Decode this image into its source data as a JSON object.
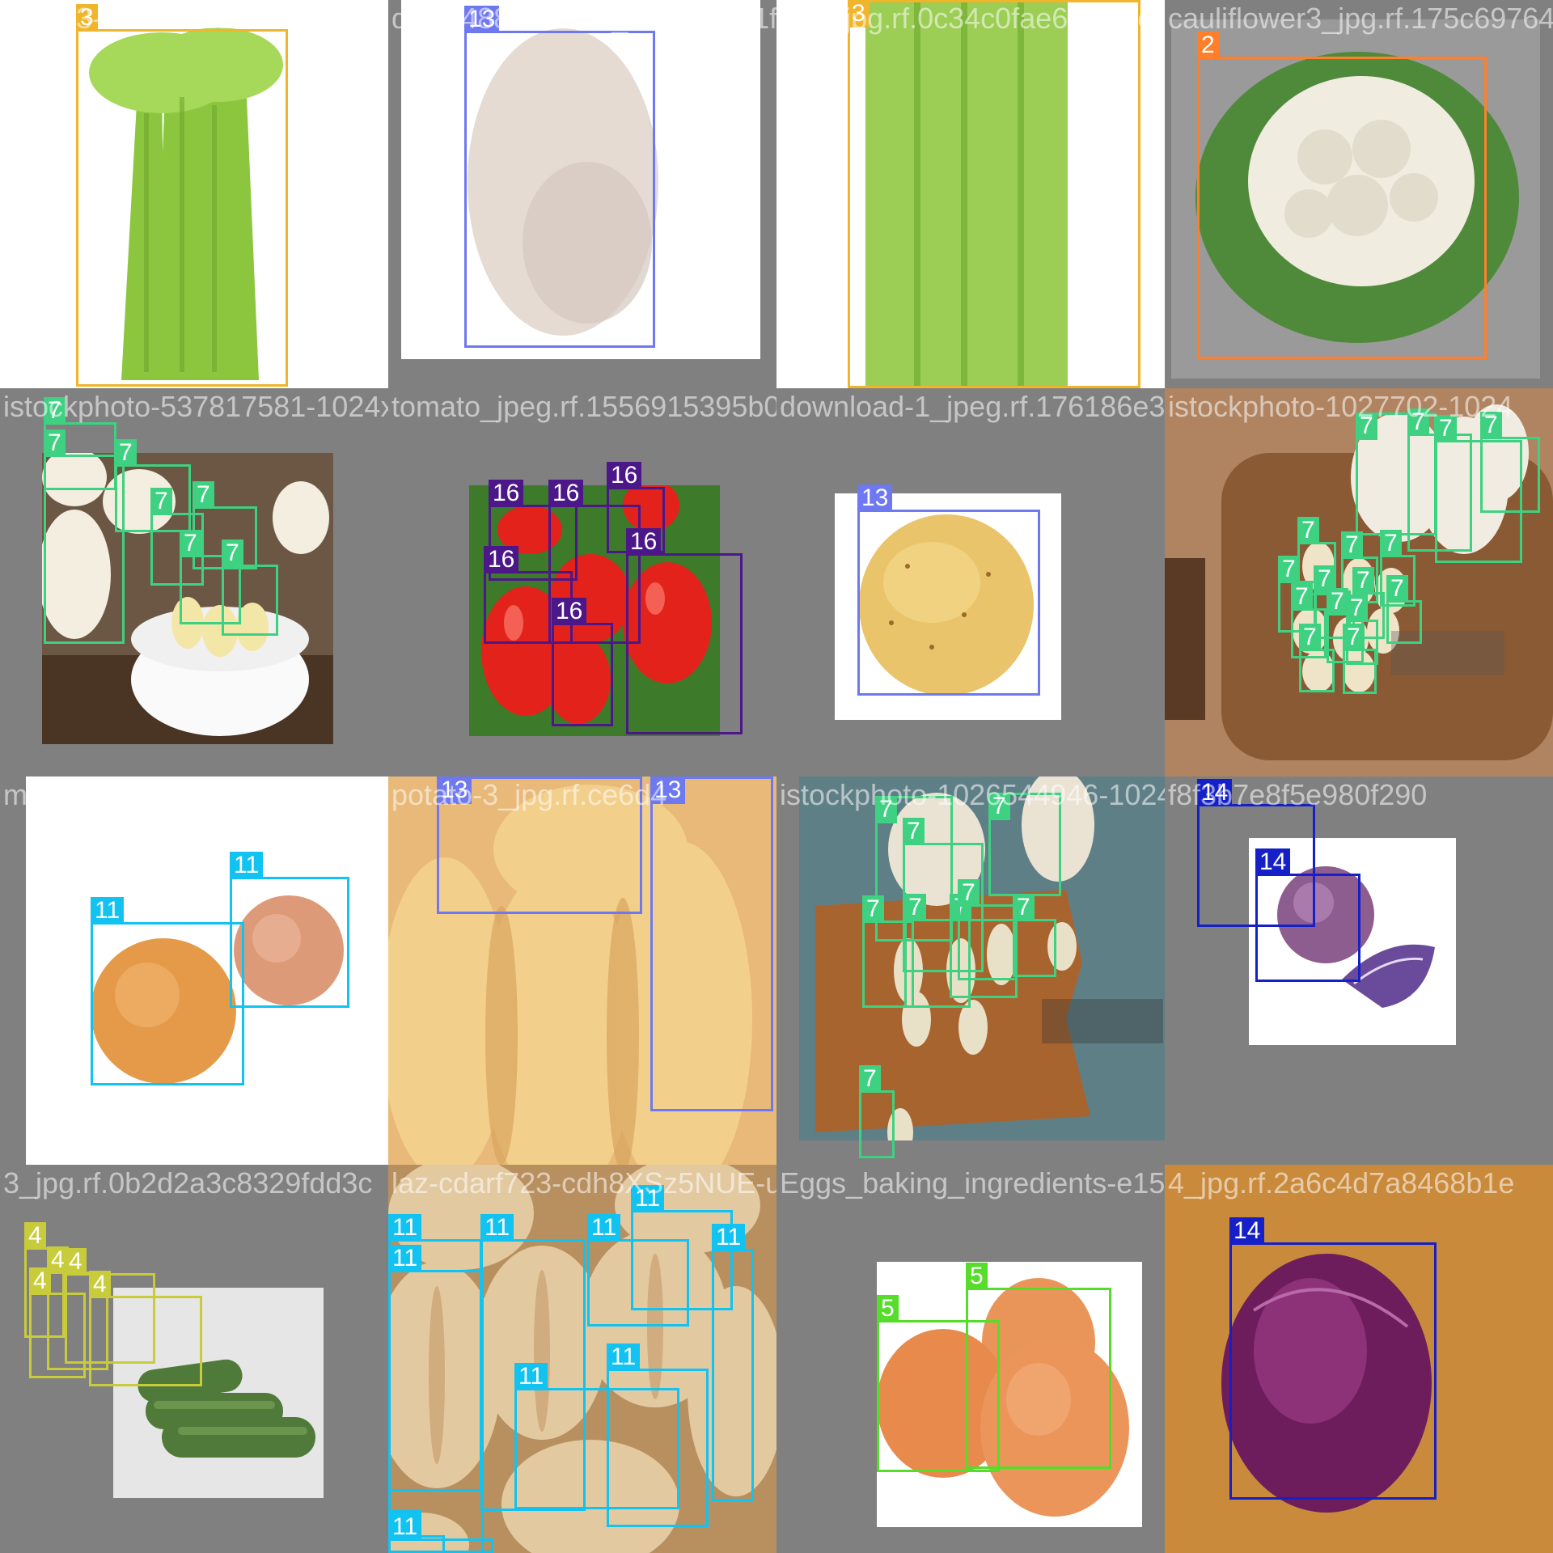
{
  "classes": {
    "2": {
      "color": "#ff7f2a"
    },
    "3": {
      "color": "#f0b52a"
    },
    "4": {
      "color": "#c9cc3a"
    },
    "5": {
      "color": "#55dd2a"
    },
    "7": {
      "color": "#3ed181"
    },
    "11": {
      "color": "#12c2f0"
    },
    "13": {
      "color": "#6e78f0"
    },
    "14": {
      "color": "#1520c8"
    },
    "16": {
      "color": "#4b1789"
    }
  },
  "tiles": [
    {
      "name": "tile-celery-1",
      "filename": "0EC13-2D5-3D11-4B2B-B807",
      "photo": {
        "bg": "#ffffff"
      },
      "boxes": [
        {
          "label": "3"
        }
      ]
    },
    {
      "name": "tile-potato-1",
      "filename": "ddwn48882580R_506b63111f2756_02a9602a_jpg.rf.",
      "photo": {
        "bg": "#ffffff"
      },
      "boxes": [
        {
          "label": "13"
        }
      ]
    },
    {
      "name": "tile-celery-2",
      "filename": "3f3f_jpg.rf.0c34c0fae63c_jpeg.rf",
      "photo": {
        "bg": "#ffffff"
      },
      "boxes": [
        {
          "label": "3"
        }
      ]
    },
    {
      "name": "tile-cauliflower",
      "filename": "cauliflower3_jpg.rf.175c69764",
      "photo": {
        "bg": "#9a9a9a"
      },
      "boxes": [
        {
          "label": "2"
        }
      ]
    },
    {
      "name": "tile-garlic-1",
      "filename": "istockphoto-537817581-1024x1024_jpg.rf.9",
      "photo": {
        "bg": "#6b5744"
      },
      "boxes": [
        {
          "label": "7"
        },
        {
          "label": "7"
        },
        {
          "label": "7"
        },
        {
          "label": "7"
        },
        {
          "label": "7"
        },
        {
          "label": "7"
        },
        {
          "label": "7"
        }
      ]
    },
    {
      "name": "tile-tomato",
      "filename": "tomato_jpeg.rf.1556915395b0039c1198895",
      "photo": {
        "bg": "#3d7a2a"
      },
      "boxes": [
        {
          "label": "16"
        },
        {
          "label": "16"
        },
        {
          "label": "16"
        },
        {
          "label": "16"
        },
        {
          "label": "16"
        },
        {
          "label": "16"
        }
      ]
    },
    {
      "name": "tile-potato-2",
      "filename": "download-1_jpeg.rf.176186e337b6660e8e77",
      "photo": {
        "bg": "#ffffff"
      },
      "boxes": [
        {
          "label": "13"
        }
      ]
    },
    {
      "name": "tile-garlic-2",
      "filename": "istockphoto-1027702-1024",
      "photo": {
        "bg": "#8a5a34"
      },
      "boxes": [
        {
          "label": "7"
        },
        {
          "label": "7"
        },
        {
          "label": "7"
        },
        {
          "label": "7"
        },
        {
          "label": "7"
        },
        {
          "label": "7"
        },
        {
          "label": "7"
        },
        {
          "label": "7"
        },
        {
          "label": "7"
        },
        {
          "label": "7"
        },
        {
          "label": "7"
        },
        {
          "label": "7"
        },
        {
          "label": "7"
        },
        {
          "label": "7"
        },
        {
          "label": "7"
        },
        {
          "label": "7"
        }
      ]
    },
    {
      "name": "tile-onion-1",
      "filename": "mockup-graphics-bC1fXU1v98w-unsplash_jpg",
      "photo": {
        "bg": "#ffffff"
      },
      "boxes": [
        {
          "label": "11"
        },
        {
          "label": "11"
        }
      ]
    },
    {
      "name": "tile-potato-3",
      "filename": "potato-3_jpg.rf.ce6d4",
      "photo": {
        "bg": "#e8b978"
      },
      "boxes": [
        {
          "label": "13"
        },
        {
          "label": "13"
        }
      ]
    },
    {
      "name": "tile-garlic-3",
      "filename": "istockphoto-1026544946-1024x1024_jpg.b",
      "photo": {
        "bg": "#5f7f86"
      },
      "boxes": [
        {
          "label": "7"
        },
        {
          "label": "7"
        },
        {
          "label": "7"
        },
        {
          "label": "7"
        },
        {
          "label": "7"
        },
        {
          "label": "7"
        },
        {
          "label": "7"
        },
        {
          "label": "7"
        },
        {
          "label": "7"
        }
      ]
    },
    {
      "name": "tile-cabbage-1",
      "filename": "f8f3b7e8f5e980f290",
      "photo": {
        "bg": "#ffffff"
      },
      "boxes": [
        {
          "label": "14"
        },
        {
          "label": "14"
        }
      ]
    },
    {
      "name": "tile-cucumber",
      "filename": "3_jpg.rf.0b2d2a3c8329fdd3c",
      "photo": {
        "bg": "#e6e6e6"
      },
      "boxes": [
        {
          "label": "4"
        },
        {
          "label": "4"
        },
        {
          "label": "4"
        },
        {
          "label": "4"
        },
        {
          "label": "4"
        }
      ]
    },
    {
      "name": "tile-onion-2",
      "filename": "laz-cdarf723-cdh8XSz5NUE-unsplash_jpg",
      "photo": {
        "bg": "#c9a678"
      },
      "boxes": [
        {
          "label": "11"
        },
        {
          "label": "11"
        },
        {
          "label": "11"
        },
        {
          "label": "11"
        },
        {
          "label": "11"
        },
        {
          "label": "11"
        },
        {
          "label": "11"
        },
        {
          "label": "11"
        },
        {
          "label": "11"
        },
        {
          "label": "11"
        }
      ]
    },
    {
      "name": "tile-eggs",
      "filename": "Eggs_baking_ingredients-e1545136",
      "photo": {
        "bg": "#ffffff"
      },
      "boxes": [
        {
          "label": "5"
        },
        {
          "label": "5"
        }
      ]
    },
    {
      "name": "tile-cabbage-2",
      "filename": "4_jpg.rf.2a6c4d7a8468b1e",
      "photo": {
        "bg": "#c98a3c"
      },
      "boxes": [
        {
          "label": "14"
        }
      ]
    }
  ]
}
